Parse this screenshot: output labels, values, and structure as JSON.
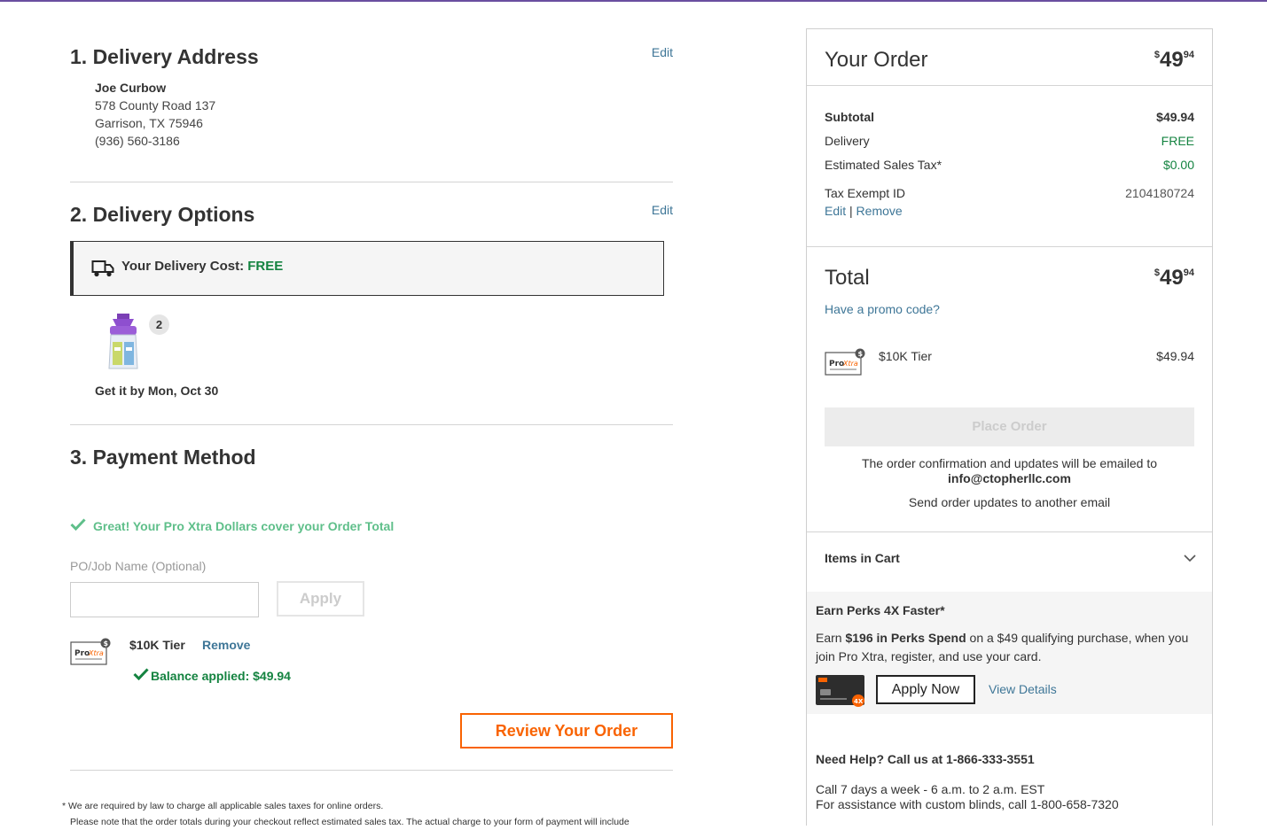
{
  "delivery_address": {
    "title": "1. Delivery Address",
    "edit_label": "Edit",
    "name": "Joe Curbow",
    "street": "578 County Road 137",
    "city": "Garrison, TX 75946",
    "phone": "(936) 560-3186"
  },
  "delivery_options": {
    "title": "2. Delivery Options",
    "edit_label": "Edit",
    "cost_label": "Your Delivery Cost:",
    "cost_value": "FREE",
    "quantity": "2",
    "eta": "Get it by Mon, Oct 30"
  },
  "payment": {
    "title": "3. Payment Method",
    "success_message": "Great! Your Pro Xtra Dollars cover your Order Total",
    "po_label": "PO/Job Name (Optional)",
    "po_value": "",
    "apply_label": "Apply",
    "tier_name": "$10K Tier",
    "remove_label": "Remove",
    "balance_applied": "Balance applied: $49.94"
  },
  "review_button": "Review Your Order",
  "footnote": {
    "line1": "* We are required by law to charge all applicable sales taxes for online orders.",
    "line2": "Please note that the order totals during your checkout reflect estimated sales tax. The actual charge to your form of payment will include"
  },
  "summary": {
    "title": "Your Order",
    "price_dollars": "49",
    "price_cents": "94",
    "price_currency": "$",
    "subtotal_label": "Subtotal",
    "subtotal_value": "$49.94",
    "delivery_label": "Delivery",
    "delivery_value": "FREE",
    "tax_label": "Estimated Sales Tax*",
    "tax_value": "$0.00",
    "tax_exempt_label": "Tax Exempt ID",
    "tax_exempt_value": "2104180724",
    "edit_label": "Edit",
    "separator": "|",
    "remove_label": "Remove",
    "total_label": "Total",
    "total_dollars": "49",
    "total_cents": "94",
    "promo_label": "Have a promo code?",
    "tier_label": "$10K Tier",
    "tier_value": "$49.94",
    "place_order_label": "Place Order",
    "confirm_text": "The order confirmation and updates will be emailed to",
    "confirm_email": "info@ctopherllc.com",
    "send_updates_label": "Send order updates to another email",
    "items_in_cart_label": "Items in Cart"
  },
  "perks": {
    "title": "Earn Perks 4X Faster*",
    "body_prefix": "Earn ",
    "body_bold": "$196 in Perks Spend",
    "body_suffix": " on a $49 qualifying purchase, when you join Pro Xtra, register, and use your card.",
    "apply_now_label": "Apply Now",
    "view_details_label": "View Details",
    "badge": "4X"
  },
  "help": {
    "title": "Need Help? Call us at 1-866-333-3551",
    "line1": "Call 7 days a week - 6 a.m. to 2 a.m. EST",
    "line2": "For assistance with custom blinds, call 1-800-658-7320"
  },
  "colors": {
    "accent_orange": "#f96302",
    "link_blue": "#3e7697",
    "success_green": "#148340",
    "top_bar": "#6a4fa0"
  }
}
